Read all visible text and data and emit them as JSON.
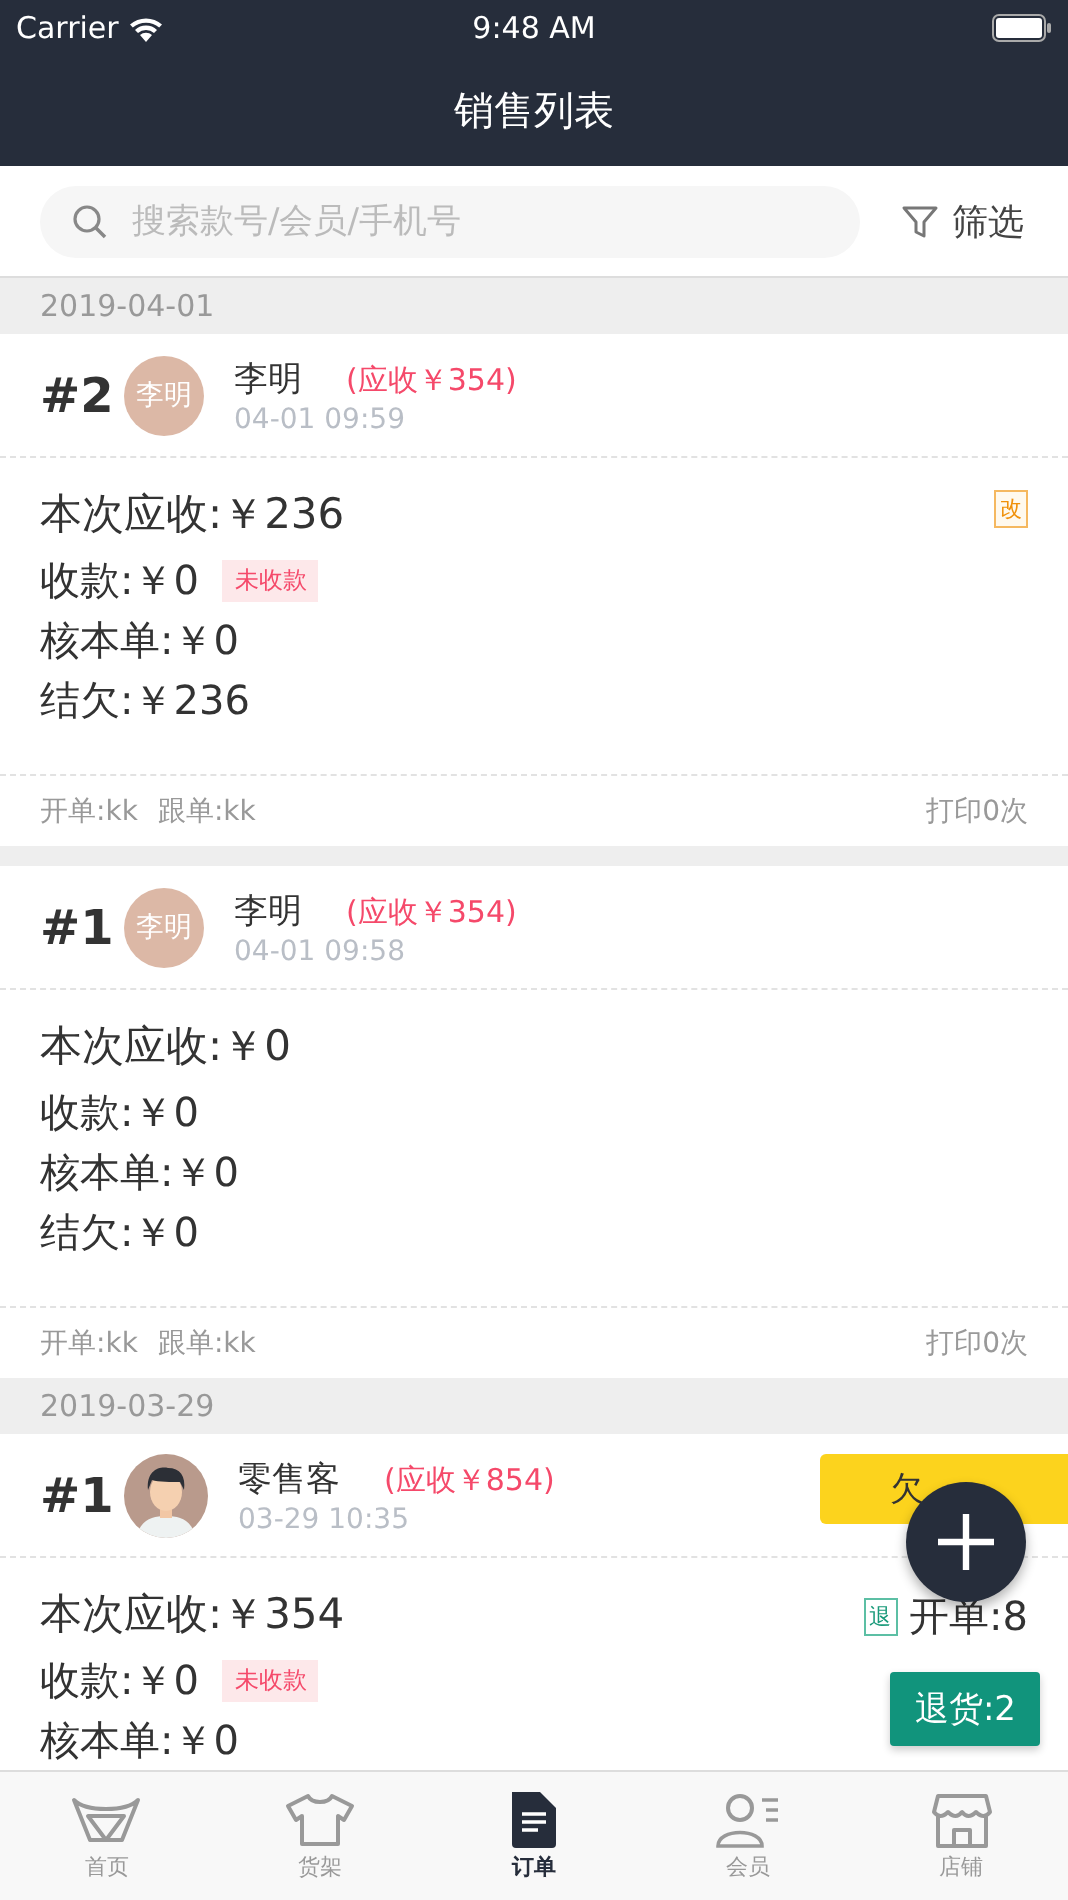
{
  "status_bar": {
    "carrier": "Carrier",
    "time": "9:48 AM"
  },
  "nav": {
    "title": "销售列表"
  },
  "search": {
    "placeholder": "搜索款号/会员/手机号"
  },
  "filter": {
    "label": "筛选"
  },
  "groups": [
    {
      "date": "2019-04-01",
      "orders": [
        {
          "number": "#2",
          "customer": "李明",
          "avatar": {
            "kind": "initials",
            "text": "李明"
          },
          "due": "(应收￥354)",
          "time": "04-01 09:59",
          "lines": [
            {
              "text": "本次应收:￥236"
            },
            {
              "text": "收款:￥0",
              "tag": "未收款"
            },
            {
              "text": "核本单:￥0"
            },
            {
              "text": "结欠:￥236"
            }
          ],
          "edit_badge": "改",
          "opener": "开单:kk",
          "follower": "跟单:kk",
          "print": "打印0次"
        },
        {
          "number": "#1",
          "customer": "李明",
          "avatar": {
            "kind": "initials",
            "text": "李明"
          },
          "due": "(应收￥354)",
          "time": "04-01 09:58",
          "lines": [
            {
              "text": "本次应收:￥0"
            },
            {
              "text": "收款:￥0"
            },
            {
              "text": "核本单:￥0"
            },
            {
              "text": "结欠:￥0"
            }
          ],
          "opener": "开单:kk",
          "follower": "跟单:kk",
          "print": "打印0次"
        }
      ]
    },
    {
      "date": "2019-03-29",
      "orders": [
        {
          "number": "#1",
          "customer": "零售客",
          "avatar": {
            "kind": "picture"
          },
          "due": "(应收￥854)",
          "time": "03-29 10:35",
          "stock_tag": "欠",
          "lines": [
            {
              "text": "本次应收:￥354"
            },
            {
              "text": "收款:￥0",
              "tag": "未收款"
            },
            {
              "text": "核本单:￥0"
            }
          ],
          "return_badge": "退",
          "open_count": "开单:8",
          "return_button": "退货:2"
        }
      ]
    }
  ],
  "tabs": [
    {
      "label": "首页",
      "kind": "basket",
      "selected": false
    },
    {
      "label": "货架",
      "kind": "shirt",
      "selected": false
    },
    {
      "label": "订单",
      "kind": "document",
      "selected": true
    },
    {
      "label": "会员",
      "kind": "member",
      "selected": false
    },
    {
      "label": "店铺",
      "kind": "store",
      "selected": false
    }
  ]
}
